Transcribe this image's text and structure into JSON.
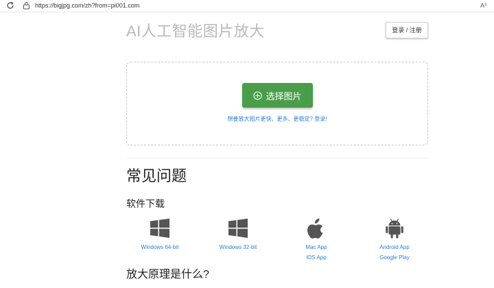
{
  "browser": {
    "url": "https://bigjpg.com/zh?from=pi001.com",
    "reader_icon_label": "A³"
  },
  "header": {
    "title": "AI人工智能图片放大",
    "login_label": "登录 / 注册"
  },
  "upload": {
    "select_label": "选择图片",
    "hint": "想要放大图片更快、更多、更稳定? 登录!"
  },
  "faq": {
    "title": "常见问题",
    "download_title": "软件下载",
    "downloads": [
      {
        "icon": "windows-icon",
        "label": "Windows 64-bit"
      },
      {
        "icon": "windows-icon",
        "label": "Windows 32-bit"
      },
      {
        "icon": "apple-icon",
        "label": "Mac App",
        "label2": "iOS App"
      },
      {
        "icon": "android-icon",
        "label": "Android App",
        "label2": "Google Play"
      }
    ],
    "principle_title": "放大原理是什么?"
  },
  "colors": {
    "accent_green": "#4a9d4a",
    "link_blue": "#2b7fd0",
    "title_gray": "#b9b9b9"
  }
}
